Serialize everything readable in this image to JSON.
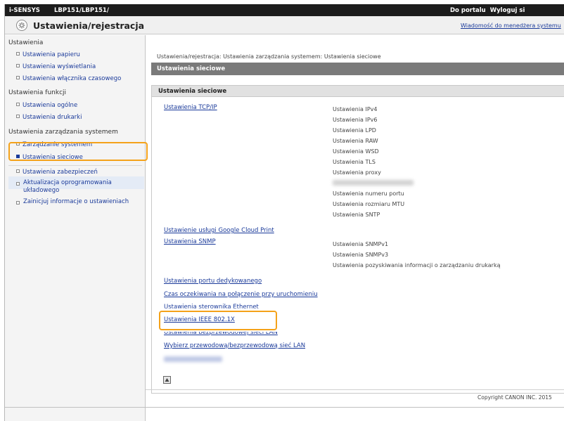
{
  "topbar": {
    "brand": "i-SENSYS",
    "model": "LBP151/LBP151/",
    "portal_link": "Do portalu",
    "logout_link": "Wyloguj si"
  },
  "header": {
    "title": "Ustawienia/rejestracja",
    "message_link": "Wiadomość do menedżera systemu"
  },
  "sidebar": {
    "sections": [
      {
        "heading": "Ustawienia",
        "items": [
          "Ustawienia papieru",
          "Ustawienia wyświetlania",
          "Ustawienia włącznika czasowego"
        ]
      },
      {
        "heading": "Ustawienia funkcji",
        "items": [
          "Ustawienia ogólne",
          "Ustawienia drukarki"
        ]
      },
      {
        "heading": "Ustawienia zarządzania systemem",
        "items": [
          "Zarządzanie systemem",
          "Ustawienia sieciowe",
          "Ustawienia zabezpieczeń",
          "Aktualizacja oprogramowania układowego",
          "Zainicjuj informacje o ustawieniach"
        ]
      }
    ]
  },
  "main": {
    "breadcrumb": "Ustawienia/rejestracja: Ustawienia zarządzania systemem: Ustawienia sieciowe",
    "section_title": "Ustawienia sieciowe",
    "box_title": "Ustawienia sieciowe",
    "tcpip": {
      "link": "Ustawienia TCP/IP",
      "subitems": [
        "Ustawienia IPv4",
        "Ustawienia IPv6",
        "Ustawienia LPD",
        "Ustawienia RAW",
        "Ustawienia WSD",
        "Ustawienia TLS",
        "Ustawienia proxy",
        "Ustawienia numeru portu",
        "Ustawienia rozmiaru MTU",
        "Ustawienia SNTP"
      ]
    },
    "google_link": "Ustawienie usługi Google Cloud Print",
    "snmp": {
      "link": "Ustawienia SNMP",
      "subitems": [
        "Ustawienia SNMPv1",
        "Ustawienia SNMPv3",
        "Ustawienia pozyskiwania informacji o zarządzaniu drukarką"
      ]
    },
    "links": [
      "Ustawienia portu dedykowanego",
      "Czas oczekiwania na połączenie przy uruchomieniu",
      "Ustawienia sterownika Ethernet",
      "Ustawienia IEEE 802.1X",
      "Ustawienia bezprzewodowej sieci LAN",
      "Wybierz przewodową/bezprzewodową sieć LAN"
    ],
    "copyright": "Copyright CANON INC. 2015"
  }
}
